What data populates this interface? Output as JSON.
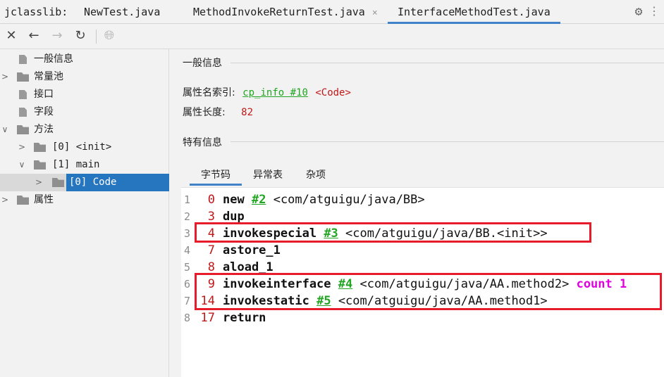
{
  "window": {
    "app_label": "jclasslib:",
    "tabs": [
      {
        "label": "NewTest.java",
        "active": false
      },
      {
        "label": "MethodInvokeReturnTest.java",
        "active": false
      },
      {
        "label": "InterfaceMethodTest.java",
        "active": true
      }
    ],
    "close_glyph": "×"
  },
  "toolbar": {
    "icons": [
      "close-icon",
      "back-arrow-icon",
      "forward-arrow-icon",
      "refresh-icon",
      "web-icon"
    ]
  },
  "tree": {
    "items": [
      {
        "label": "一般信息",
        "type": "file",
        "level": 0,
        "expandable": false
      },
      {
        "label": "常量池",
        "type": "folder",
        "level": 0,
        "expandable": true,
        "expanded": false
      },
      {
        "label": "接口",
        "type": "file",
        "level": 0,
        "expandable": false
      },
      {
        "label": "字段",
        "type": "file",
        "level": 0,
        "expandable": false
      },
      {
        "label": "方法",
        "type": "folder",
        "level": 0,
        "expandable": true,
        "expanded": true
      },
      {
        "label": "[0] <init>",
        "type": "folder",
        "level": 1,
        "expandable": true,
        "expanded": false
      },
      {
        "label": "[1] main",
        "type": "folder",
        "level": 1,
        "expandable": true,
        "expanded": true
      },
      {
        "label": "[0] Code",
        "type": "folder",
        "level": 2,
        "expandable": true,
        "expanded": false,
        "selected": true
      },
      {
        "label": "属性",
        "type": "folder",
        "level": 0,
        "expandable": true,
        "expanded": false
      }
    ]
  },
  "general_info": {
    "title": "一般信息",
    "name_index_label": "属性名索引:",
    "name_index_link": "cp_info #10",
    "name_index_value": "<Code>",
    "length_label": "属性长度:",
    "length_value": "82"
  },
  "specific_info": {
    "title": "特有信息",
    "tabs": [
      {
        "label": "字节码",
        "active": true
      },
      {
        "label": "异常表",
        "active": false
      },
      {
        "label": "杂项",
        "active": false
      }
    ]
  },
  "bytecode": [
    {
      "line": "1",
      "offset": "0",
      "op": "new",
      "ref": "#2",
      "cls": "<com/atguigu/java/BB>",
      "extra": ""
    },
    {
      "line": "2",
      "offset": "3",
      "op": "dup",
      "ref": "",
      "cls": "",
      "extra": ""
    },
    {
      "line": "3",
      "offset": "4",
      "op": "invokespecial",
      "ref": "#3",
      "cls": "<com/atguigu/java/BB.<init>>",
      "extra": ""
    },
    {
      "line": "4",
      "offset": "7",
      "op": "astore_1",
      "ref": "",
      "cls": "",
      "extra": ""
    },
    {
      "line": "5",
      "offset": "8",
      "op": "aload_1",
      "ref": "",
      "cls": "",
      "extra": ""
    },
    {
      "line": "6",
      "offset": "9",
      "op": "invokeinterface",
      "ref": "#4",
      "cls": "<com/atguigu/java/AA.method2>",
      "extra": "count 1"
    },
    {
      "line": "7",
      "offset": "14",
      "op": "invokestatic",
      "ref": "#5",
      "cls": "<com/atguigu/java/AA.method1>",
      "extra": ""
    },
    {
      "line": "8",
      "offset": "17",
      "op": "return",
      "ref": "",
      "cls": "",
      "extra": ""
    }
  ],
  "colors": {
    "accent": "#4083c9",
    "selection": "#2675bf",
    "link": "#22a522",
    "offset": "#c01818",
    "count": "#e000e0",
    "highlight_box": "#e81b2a"
  }
}
